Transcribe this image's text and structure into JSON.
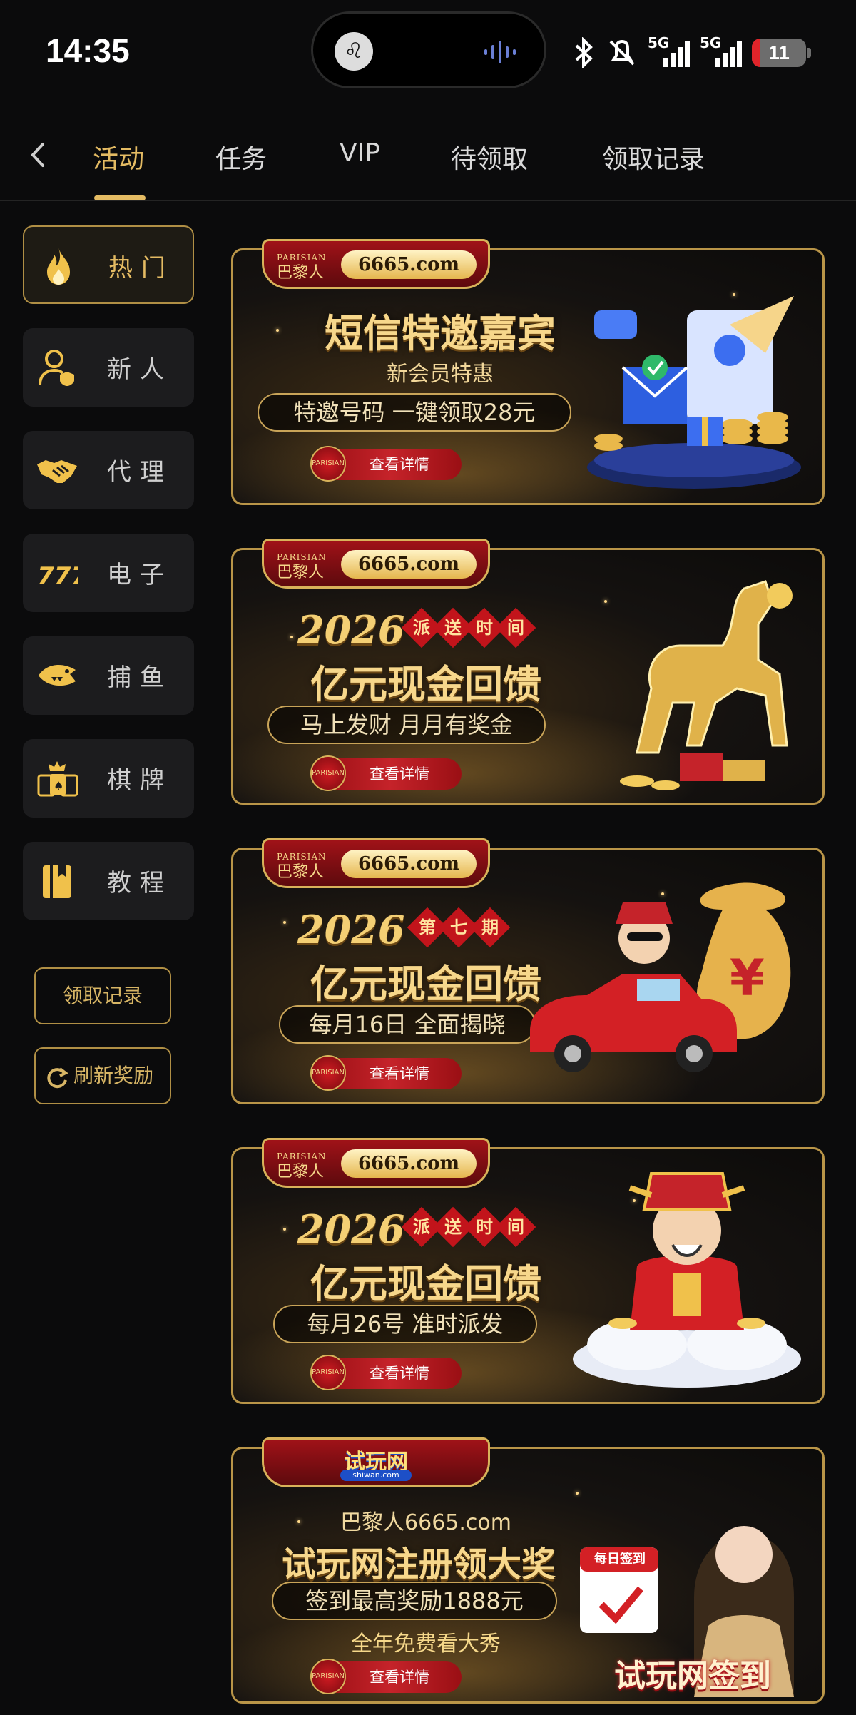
{
  "status_bar": {
    "time": "14:35",
    "network_1": "5G",
    "network_2": "5G",
    "battery": "11"
  },
  "tabs": [
    {
      "label": "活动",
      "active": true
    },
    {
      "label": "任务",
      "active": false
    },
    {
      "label": "VIP",
      "active": false
    },
    {
      "label": "待领取",
      "active": false
    },
    {
      "label": "领取记录",
      "active": false
    }
  ],
  "sidebar": {
    "items": [
      {
        "label": "热门",
        "icon": "flame-icon",
        "active": true
      },
      {
        "label": "新人",
        "icon": "new-user-icon",
        "active": false
      },
      {
        "label": "代理",
        "icon": "handshake-icon",
        "active": false
      },
      {
        "label": "电子",
        "icon": "slot-777-icon",
        "active": false
      },
      {
        "label": "捕鱼",
        "icon": "shark-icon",
        "active": false
      },
      {
        "label": "棋牌",
        "icon": "cards-icon",
        "active": false
      },
      {
        "label": "教程",
        "icon": "book-icon",
        "active": false
      }
    ],
    "claim_records_button": "领取记录",
    "refresh_rewards_button": "刷新奖励"
  },
  "banners": [
    {
      "brand_en": "PARISIAN",
      "brand_cn": "巴黎人",
      "domain": "6665.com",
      "title": "短信特邀嘉宾",
      "subtitle": "新会员特惠",
      "pill": "特邀号码 一键领取28元",
      "button": "查看详情"
    },
    {
      "brand_en": "PARISIAN",
      "brand_cn": "巴黎人",
      "domain": "6665.com",
      "year": "2026",
      "tag": [
        "派",
        "送",
        "时",
        "间"
      ],
      "title": "亿元现金回馈",
      "pill": "马上发财 月月有奖金",
      "button": "查看详情"
    },
    {
      "brand_en": "PARISIAN",
      "brand_cn": "巴黎人",
      "domain": "6665.com",
      "year": "2026",
      "tag": [
        "第",
        "七",
        "期"
      ],
      "title": "亿元现金回馈",
      "pill": "每月16日 全面揭晓",
      "button": "查看详情"
    },
    {
      "brand_en": "PARISIAN",
      "brand_cn": "巴黎人",
      "domain": "6665.com",
      "year": "2026",
      "tag": [
        "派",
        "送",
        "时",
        "间"
      ],
      "title": "亿元现金回馈",
      "pill": "每月26号 准时派发",
      "button": "查看详情"
    },
    {
      "logo_cn": "试玩网",
      "logo_en": "shiwan.com",
      "site_line": "巴黎人6665.com",
      "title": "试玩网注册领大奖",
      "pill": "签到最高奖励1888元",
      "subtitle": "全年免费看大秀",
      "calendar_label": "每日签到",
      "art_caption": "试玩网签到",
      "button": "查看详情"
    }
  ],
  "colors": {
    "accent_gold": "#e4bb63",
    "background": "#0b0b0c",
    "card": "#1c1c1e",
    "banner_red": "#c2141b"
  }
}
